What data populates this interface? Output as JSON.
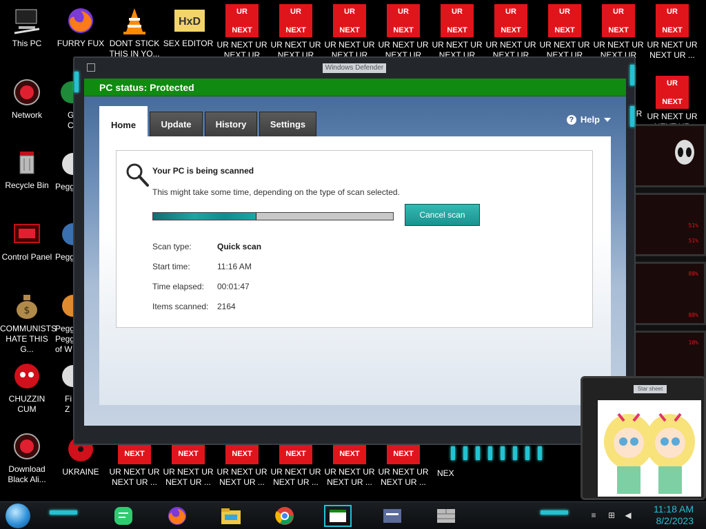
{
  "desktop": {
    "icons_left": [
      {
        "label": "This PC"
      },
      {
        "label": "Network"
      },
      {
        "label": "Recycle Bin"
      },
      {
        "label": "Control Panel"
      },
      {
        "label": "COMMUNISTS HATE THIS G..."
      },
      {
        "label": "CHUZZIN CUM"
      },
      {
        "label": "Download Black Ali..."
      }
    ],
    "icons_top": [
      {
        "label": "FURRY FUX"
      },
      {
        "label": "DONT STICK THIS IN YO..."
      },
      {
        "label": "SEX EDITOR"
      }
    ],
    "partial_labels": [
      "G",
      "C",
      "Pegg",
      "Pegg",
      "Pegg",
      "Pegg of W",
      "Fi",
      "Z"
    ],
    "ur_box": {
      "top": "UR",
      "bottom": "NEXT"
    },
    "ur_label_top": "UR NEXT UR",
    "ur_label_bottom": "NEXT UR ...",
    "ur_label_bottom_short": "NEXT UR",
    "next_box": "NEXT",
    "ukraine": {
      "label": "UKRAINE"
    },
    "nex_partial": "NEX",
    "ur_partial": "UR"
  },
  "right_deco": {
    "labels": [
      "51%",
      "51%",
      "88%",
      "88%",
      "18%"
    ]
  },
  "window": {
    "title": "Windows Defender",
    "status": "PC status: Protected",
    "tabs": [
      "Home",
      "Update",
      "History",
      "Settings"
    ],
    "help": "Help",
    "scan": {
      "heading": "Your PC is being scanned",
      "subtitle": "This might take some time, depending on the type of scan selected.",
      "progress_fraction": 0.43,
      "cancel_label": "Cancel scan",
      "rows": [
        {
          "key": "Scan type:",
          "value": "Quick scan",
          "bold": true
        },
        {
          "key": "Start time:",
          "value": "11:16 AM"
        },
        {
          "key": "Time elapsed:",
          "value": "00:01:47"
        },
        {
          "key": "Items scanned:",
          "value": "2164"
        }
      ]
    }
  },
  "widget": {
    "title": "Star sheet"
  },
  "taskbar": {
    "time": "11:18 AM",
    "date": "8/2/2023"
  },
  "colors": {
    "status_green": "#108a10",
    "accent_teal": "#21c3d3",
    "ur_red": "#e0151b"
  }
}
